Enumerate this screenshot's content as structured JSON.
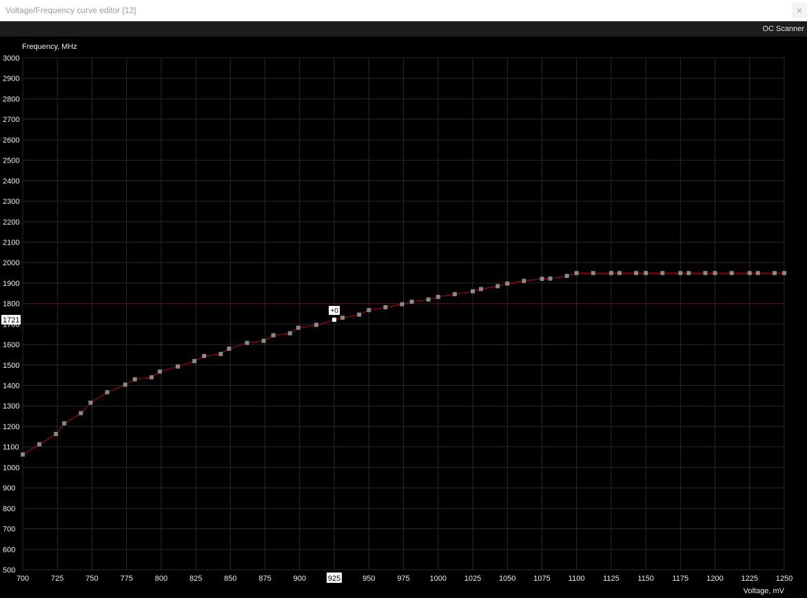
{
  "window": {
    "title": "Voltage/Frequency curve editor [12]",
    "close_glyph": "×"
  },
  "toolbar": {
    "oc_scanner_label": "OC Scanner"
  },
  "colors": {
    "background": "#000000",
    "grid": "#2a2a2a",
    "curve": "#c00000",
    "point": "#8a8a8a",
    "selected_point": "#ffffff",
    "reference_line": "#7a0000"
  },
  "chart_data": {
    "type": "line",
    "ylabel": "Frequency, MHz",
    "xlabel": "Voltage, mV",
    "xlim": [
      700,
      1250
    ],
    "ylim": [
      500,
      3000
    ],
    "x_ticks": [
      700,
      725,
      750,
      775,
      800,
      825,
      850,
      875,
      900,
      925,
      950,
      975,
      1000,
      1025,
      1050,
      1075,
      1100,
      1125,
      1150,
      1175,
      1200,
      1225,
      1250
    ],
    "y_ticks": [
      500,
      600,
      700,
      800,
      900,
      1000,
      1100,
      1200,
      1300,
      1400,
      1500,
      1600,
      1700,
      1800,
      1900,
      2000,
      2100,
      2200,
      2300,
      2400,
      2500,
      2600,
      2700,
      2800,
      2900,
      3000
    ],
    "grid": true,
    "reference_frequency": 1800,
    "selected": {
      "voltage": 925,
      "voltage_label": "925",
      "frequency": 1721,
      "frequency_label": "1721",
      "offset_label": "+0"
    },
    "points": [
      [
        700,
        1063
      ],
      [
        712,
        1113
      ],
      [
        724,
        1163
      ],
      [
        730,
        1215
      ],
      [
        742,
        1265
      ],
      [
        749,
        1316
      ],
      [
        761,
        1367
      ],
      [
        774,
        1404
      ],
      [
        781,
        1430
      ],
      [
        793,
        1440
      ],
      [
        799,
        1468
      ],
      [
        812,
        1493
      ],
      [
        824,
        1519
      ],
      [
        831,
        1544
      ],
      [
        843,
        1554
      ],
      [
        849,
        1580
      ],
      [
        862,
        1608
      ],
      [
        874,
        1618
      ],
      [
        881,
        1645
      ],
      [
        893,
        1655
      ],
      [
        899,
        1682
      ],
      [
        912,
        1696
      ],
      [
        925,
        1721
      ],
      [
        931,
        1731
      ],
      [
        943,
        1746
      ],
      [
        950,
        1768
      ],
      [
        962,
        1782
      ],
      [
        974,
        1797
      ],
      [
        981,
        1809
      ],
      [
        993,
        1820
      ],
      [
        1000,
        1833
      ],
      [
        1012,
        1846
      ],
      [
        1025,
        1860
      ],
      [
        1031,
        1871
      ],
      [
        1043,
        1885
      ],
      [
        1050,
        1898
      ],
      [
        1062,
        1911
      ],
      [
        1075,
        1921
      ],
      [
        1081,
        1922
      ],
      [
        1093,
        1935
      ],
      [
        1100,
        1949
      ],
      [
        1112,
        1949
      ],
      [
        1125,
        1949
      ],
      [
        1131,
        1949
      ],
      [
        1143,
        1949
      ],
      [
        1150,
        1949
      ],
      [
        1162,
        1949
      ],
      [
        1175,
        1949
      ],
      [
        1181,
        1949
      ],
      [
        1193,
        1949
      ],
      [
        1200,
        1949
      ],
      [
        1212,
        1949
      ],
      [
        1225,
        1949
      ],
      [
        1231,
        1949
      ],
      [
        1243,
        1949
      ],
      [
        1250,
        1949
      ]
    ]
  }
}
